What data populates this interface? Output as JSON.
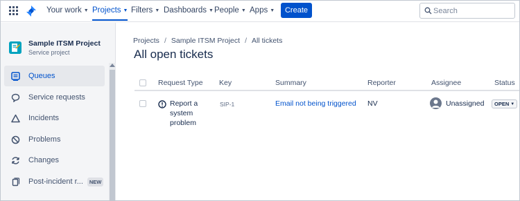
{
  "topnav": {
    "items": [
      {
        "label": "Your work",
        "chevron": "chevron-down-icon"
      },
      {
        "label": "Projects",
        "chevron": "chevron-down-icon",
        "active": true
      },
      {
        "label": "Filters",
        "chevron": "chevron-down-icon"
      },
      {
        "label": "Dashboards",
        "chevron": "chevron-down-icon"
      },
      {
        "label": "People",
        "chevron": "chevron-down-icon"
      },
      {
        "label": "Apps",
        "chevron": "chevron-down-icon"
      }
    ],
    "create_label": "Create",
    "search_placeholder": "Search",
    "accent_color": "#0052cc"
  },
  "sidebar": {
    "project_name": "Sample ITSM Project",
    "project_type": "Service project",
    "items": [
      {
        "label": "Queues",
        "icon": "queues-icon",
        "selected": true
      },
      {
        "label": "Service requests",
        "icon": "chat-bubble-icon"
      },
      {
        "label": "Incidents",
        "icon": "warning-triangle-icon"
      },
      {
        "label": "Problems",
        "icon": "no-entry-icon"
      },
      {
        "label": "Changes",
        "icon": "changes-icon"
      },
      {
        "label": "Post-incident r...",
        "icon": "document-icon",
        "badge": "NEW"
      }
    ]
  },
  "main": {
    "breadcrumb": [
      "Projects",
      "Sample ITSM Project",
      "All tickets"
    ],
    "breadcrumb_separator": "/",
    "title": "All open tickets",
    "columns": [
      "Request Type",
      "Key",
      "Summary",
      "Reporter",
      "Assignee",
      "Status"
    ],
    "rows": [
      {
        "request_type": "Report a system problem",
        "request_icon": "alert-circle-icon",
        "key": "SIP-1",
        "summary": "Email not being triggered",
        "reporter": "NV",
        "assignee": "Unassigned",
        "status": "OPEN"
      }
    ]
  }
}
